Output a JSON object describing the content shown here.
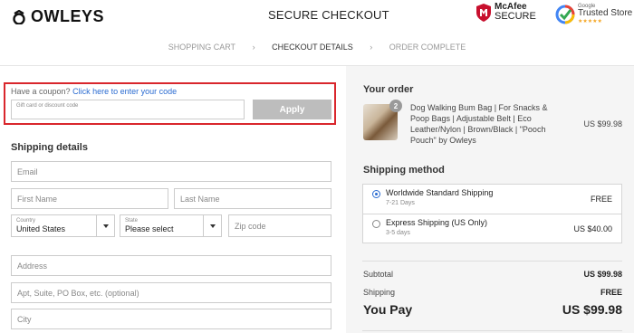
{
  "header": {
    "logo_text": "OWLEYS",
    "title": "SECURE CHECKOUT",
    "mcafee_line1": "McAfee",
    "mcafee_line2": "SECURE",
    "trusted_small": "Google",
    "trusted_big": "Trusted Store",
    "trusted_stars": "★★★★★"
  },
  "steps": [
    {
      "label": "SHOPPING CART"
    },
    {
      "label": "CHECKOUT DETAILS"
    },
    {
      "label": "ORDER COMPLETE"
    }
  ],
  "coupon": {
    "prompt": "Have a coupon?",
    "link": "Click here to enter your code",
    "placeholder": "Gift card or discount code",
    "apply_label": "Apply"
  },
  "shipping_details": {
    "title": "Shipping details",
    "email_placeholder": "Email",
    "first_name_placeholder": "First Name",
    "last_name_placeholder": "Last Name",
    "country_label": "Country",
    "country_value": "United States",
    "state_label": "State",
    "state_value": "Please select",
    "zip_placeholder": "Zip code",
    "address_placeholder": "Address",
    "apt_placeholder": "Apt, Suite, PO Box, etc. (optional)",
    "city_placeholder": "City"
  },
  "order": {
    "title": "Your order",
    "quantity": "2",
    "product_name": "Dog Walking Bum Bag | For Snacks & Poop Bags | Adjustable Belt | Eco Leather/Nylon | Brown/Black | \"Pooch Pouch\" by Owleys",
    "product_price": "US $99.98"
  },
  "shipping_method": {
    "title": "Shipping method",
    "options": [
      {
        "name": "Worldwide Standard Shipping",
        "days": "7-21 Days",
        "price": "FREE",
        "selected": true
      },
      {
        "name": "Express Shipping (US Only)",
        "days": "3-5 days",
        "price": "US $40.00",
        "selected": false
      }
    ]
  },
  "summary": {
    "subtotal_label": "Subtotal",
    "subtotal_value": "US $99.98",
    "shipping_label": "Shipping",
    "shipping_value": "FREE",
    "total_label": "You Pay",
    "total_value": "US $99.98"
  },
  "colors": {
    "accent_blue": "#2a6bd1",
    "highlight_red": "#d9262c",
    "apply_gray": "#bdbdbd"
  }
}
